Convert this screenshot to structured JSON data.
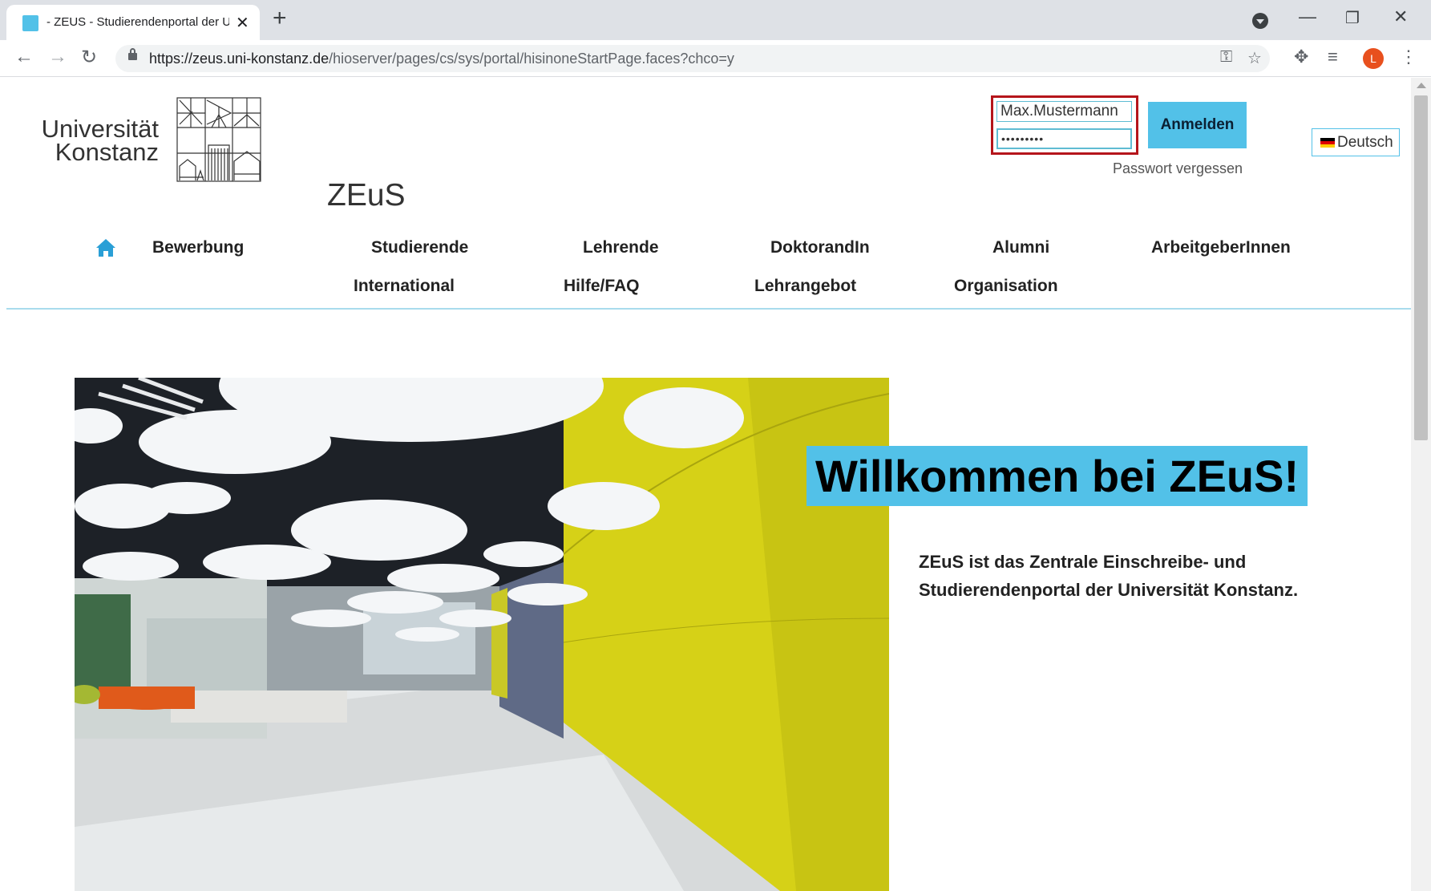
{
  "browser": {
    "tab_title": "- ZEUS - Studierendenportal der Universität Konstanz",
    "url_host": "https://zeus.uni-konstanz.de",
    "url_path": "/hioserver/pages/cs/sys/portal/hisinoneStartPage.faces?chco=y",
    "profile_initial": "L"
  },
  "header": {
    "logo_line1": "Universität",
    "logo_line2": "Konstanz",
    "app_title": "ZEuS"
  },
  "login": {
    "username_value": "Max.Mustermann",
    "password_value": "•••••••••",
    "login_button": "Anmelden",
    "forgot_password": "Passwort vergessen",
    "language": "Deutsch"
  },
  "nav": {
    "row1": [
      "Bewerbung",
      "Studierende",
      "Lehrende",
      "DoktorandIn",
      "Alumni",
      "ArbeitgeberInnen"
    ],
    "row2": [
      "International",
      "Hilfe/FAQ",
      "Lehrangebot",
      "Organisation"
    ]
  },
  "main": {
    "welcome_heading": "Willkommen bei ZEuS!",
    "intro_line1": "ZEuS ist das Zentrale Einschreibe- und",
    "intro_line2": "Studierendenportal der Universität Konstanz."
  },
  "colors": {
    "accent": "#52c1e8",
    "highlight_frame": "#b5151b",
    "nav_rule": "#a9dced"
  }
}
